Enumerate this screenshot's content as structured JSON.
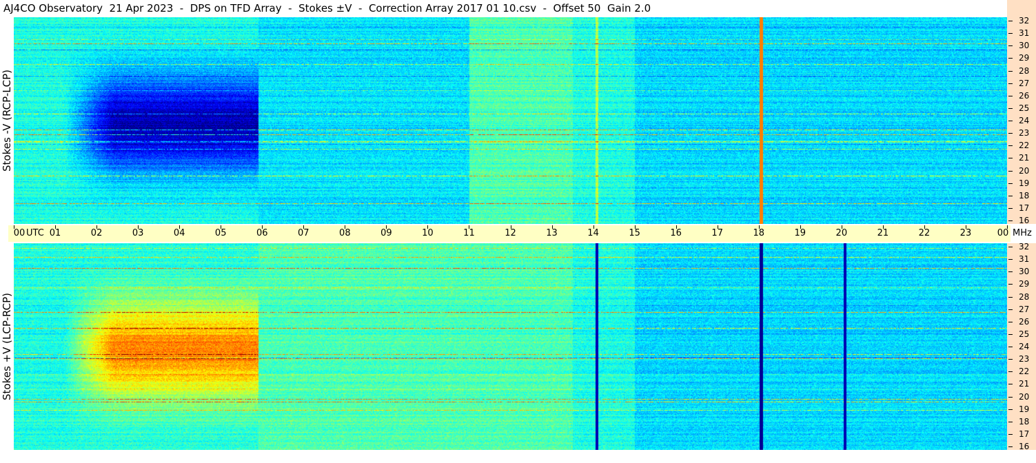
{
  "title": "AJ4CO Observatory  21 Apr 2023  -  DPS on TFD Array  -  Stokes ±V  -  Correction Array 2017 01 10.csv  -  Offset 50  Gain 2.0",
  "chart_data": [
    {
      "type": "heatmap",
      "panel": "top",
      "ylabel": "Stokes -V (RCP-LCP)",
      "x_ticks": [
        "00",
        "01",
        "02",
        "03",
        "04",
        "05",
        "06",
        "07",
        "08",
        "09",
        "10",
        "11",
        "12",
        "13",
        "14",
        "15",
        "16",
        "17",
        "18",
        "19",
        "20",
        "21",
        "22",
        "23",
        "00"
      ],
      "x_unit": "UTC",
      "y_ticks": [
        "32",
        "31",
        "30",
        "29",
        "28",
        "27",
        "26",
        "25",
        "24",
        "23",
        "22",
        "21",
        "20",
        "19",
        "18",
        "17",
        "16"
      ],
      "y_unit": "MHz",
      "ylim": [
        16,
        32
      ],
      "xlim": [
        0,
        24
      ]
    },
    {
      "type": "heatmap",
      "panel": "bottom",
      "ylabel": "Stokes +V (LCP-RCP)",
      "x_ticks": [
        "00",
        "01",
        "02",
        "03",
        "04",
        "05",
        "06",
        "07",
        "08",
        "09",
        "10",
        "11",
        "12",
        "13",
        "14",
        "15",
        "16",
        "17",
        "18",
        "19",
        "20",
        "21",
        "22",
        "23",
        "00"
      ],
      "x_unit": "UTC",
      "y_ticks": [
        "32",
        "31",
        "30",
        "29",
        "28",
        "27",
        "26",
        "25",
        "24",
        "23",
        "22",
        "21",
        "20",
        "19",
        "18",
        "17",
        "16"
      ],
      "y_unit": "MHz",
      "ylim": [
        16,
        32
      ],
      "xlim": [
        0,
        24
      ]
    }
  ],
  "time_axis": {
    "utc_label": "UTC",
    "mhz_label": "MHz"
  },
  "colors": {
    "scale_bg": "#ffe0c4",
    "axis_bg": "#ffffc4"
  }
}
